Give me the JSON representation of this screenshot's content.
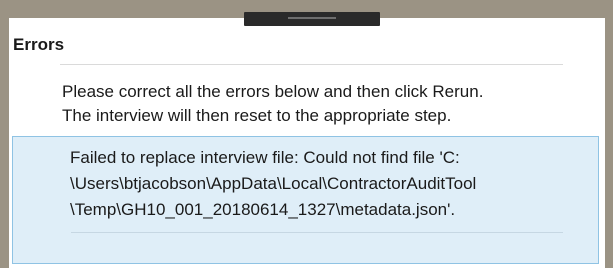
{
  "dialog": {
    "title": "Errors",
    "instructions": [
      "Please correct all the errors below and then click Rerun.",
      "The interview will then reset to the appropriate step."
    ]
  },
  "errors": [
    {
      "lines": [
        "Failed to replace interview file: Could not find file 'C:",
        "\\Users\\btjacobson\\AppData\\Local\\ContractorAuditTool",
        "\\Temp\\GH10_001_20180614_1327\\metadata.json'."
      ]
    }
  ],
  "colors": {
    "frame": "#9b9384",
    "error_background": "#dfeef8",
    "error_border": "#8fc3e4"
  }
}
